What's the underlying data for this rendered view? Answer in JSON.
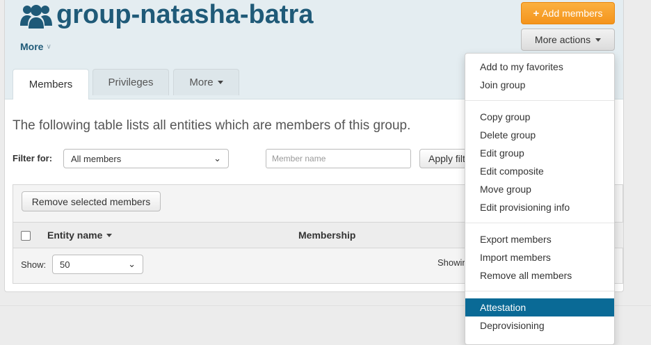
{
  "header": {
    "title": "group-natasha-batra",
    "more_label": "More",
    "add_members_label": "Add members",
    "more_actions_label": "More actions"
  },
  "tabs": [
    {
      "label": "Members",
      "active": true
    },
    {
      "label": "Privileges",
      "active": false
    },
    {
      "label": "More",
      "active": false
    }
  ],
  "main": {
    "intro": "The following table lists all entities which are members of this group.",
    "filter_label": "Filter for:",
    "filter_value": "All members",
    "member_name_placeholder": "Member name",
    "apply_filter_label": "Apply filter",
    "remove_selected_label": "Remove selected members",
    "columns": [
      "Entity name",
      "Membership"
    ],
    "show_label": "Show:",
    "page_size": "50",
    "showing_text": "Showing"
  },
  "menu": {
    "groups": [
      [
        "Add to my favorites",
        "Join group"
      ],
      [
        "Copy group",
        "Delete group",
        "Edit group",
        "Edit composite",
        "Move group",
        "Edit provisioning info"
      ],
      [
        "Export members",
        "Import members",
        "Remove all members"
      ],
      [
        "Attestation",
        "Deprovisioning"
      ]
    ],
    "active_item": "Attestation"
  },
  "colors": {
    "brand": "#1f5a78",
    "orange": "#f4941c",
    "menu_active": "#0a6a96",
    "header_bg": "#e4edf1"
  }
}
